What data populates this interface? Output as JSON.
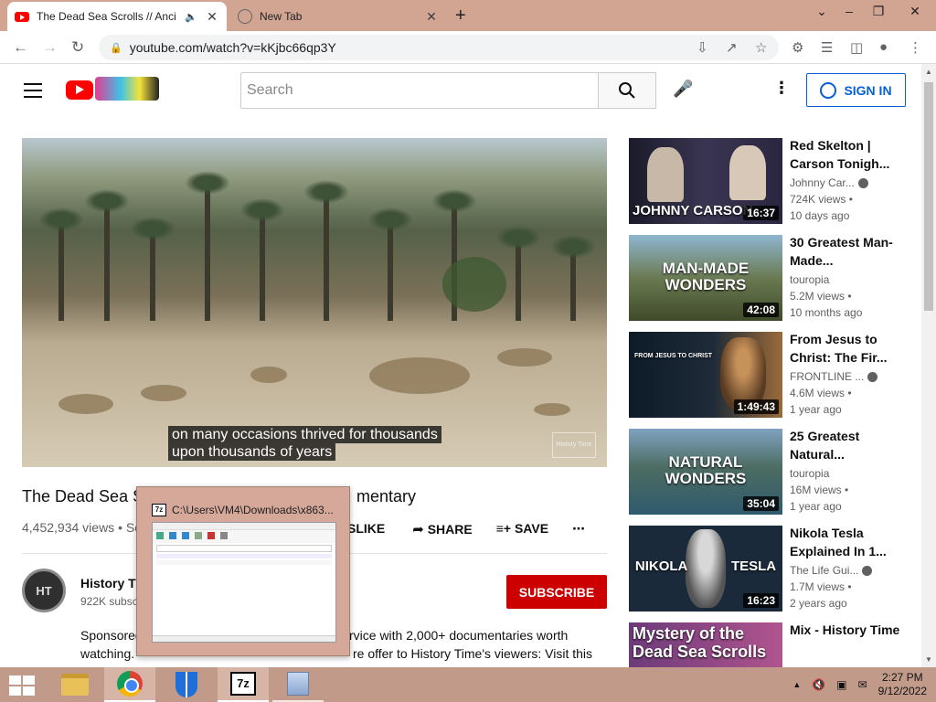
{
  "browser": {
    "tabs": [
      {
        "title": "The Dead Sea Scrolls // Anci",
        "active": true
      },
      {
        "title": "New Tab",
        "active": false
      }
    ],
    "url": "youtube.com/watch?v=kKjbc66qp3Y"
  },
  "youtube": {
    "search_placeholder": "Search",
    "signin_label": "SIGN IN"
  },
  "video": {
    "caption_line1": "on many occasions thrived for thousands",
    "caption_line2": "upon thousands of years",
    "watermark": "History Time",
    "title_left": "The Dead Sea S",
    "title_right": "mentary",
    "views": "4,452,934 views • Se",
    "actions": {
      "dislike": "SLIKE",
      "share": "SHARE",
      "save": "SAVE"
    },
    "channel": {
      "avatar_text": "HT",
      "name": "History Tim",
      "subs": "922K subsc"
    },
    "subscribe_label": "SUBSCRIBE",
    "description_line1_left": "Sponsored",
    "description_line1_right": "rvice with 2,000+ documentaries worth",
    "description_line2_left": "watching.",
    "description_line2_right": "re offer to History Time's viewers: Visit this"
  },
  "recommendations": [
    {
      "title": "Red Skelton | Carson Tonigh...",
      "channel": "Johnny Car...",
      "verified": true,
      "views": "724K views •",
      "age": "10 days ago",
      "duration": "16:37",
      "thumb_text": "JOHNNY CARSON"
    },
    {
      "title": "30 Greatest Man-Made...",
      "channel": "touropia",
      "verified": false,
      "views": "5.2M views •",
      "age": "10 months ago",
      "duration": "42:08",
      "thumb_text": "MAN-MADE WONDERS"
    },
    {
      "title": "From Jesus to Christ: The Fir...",
      "channel": "FRONTLINE ...",
      "verified": true,
      "views": "4.6M views •",
      "age": "1 year ago",
      "duration": "1:49:43",
      "thumb_text": "FROM JESUS TO CHRIST"
    },
    {
      "title": "25 Greatest Natural...",
      "channel": "touropia",
      "verified": false,
      "views": "16M views •",
      "age": "1 year ago",
      "duration": "35:04",
      "thumb_text": "NATURAL WONDERS"
    },
    {
      "title": "Nikola Tesla Explained In 1...",
      "channel": "The Life Gui...",
      "verified": true,
      "views": "1.7M views •",
      "age": "2 years ago",
      "duration": "16:23",
      "thumb_text": "NIKOLA TESLA"
    },
    {
      "title": "Mix - History Time",
      "channel": "",
      "verified": false,
      "views": "",
      "age": "",
      "duration": "",
      "thumb_text": "Mystery of the Dead Sea Scrolls"
    }
  ],
  "popup": {
    "title": "C:\\Users\\VM4\\Downloads\\x863..."
  },
  "taskbar": {
    "time": "2:27 PM",
    "date": "9/12/2022"
  }
}
